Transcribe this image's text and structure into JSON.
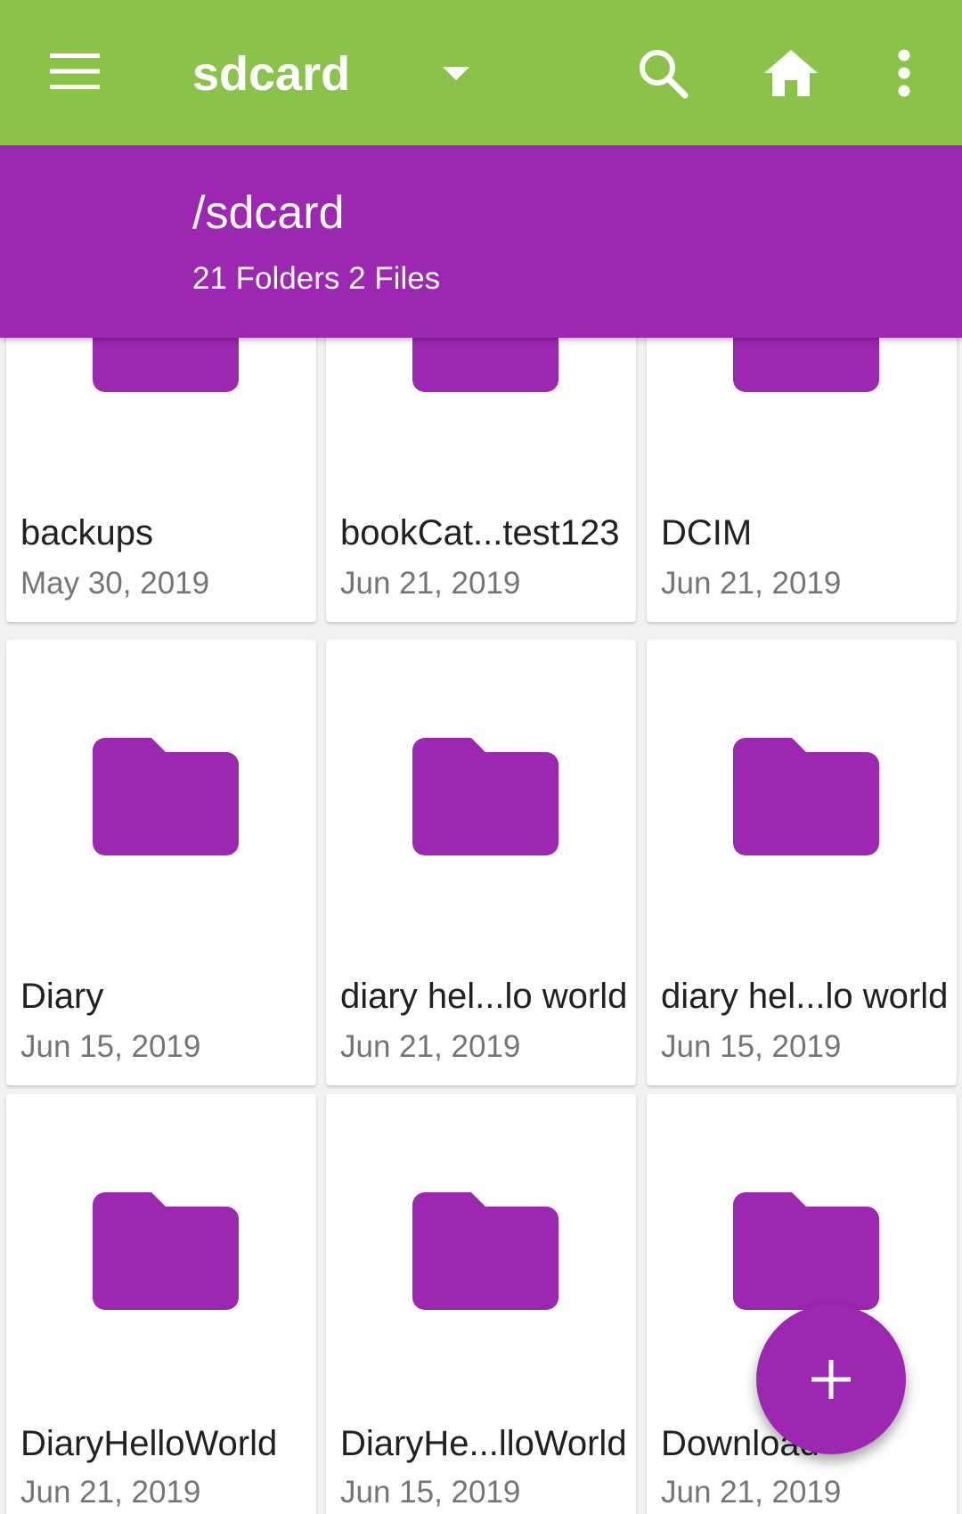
{
  "toolbar": {
    "title": "sdcard",
    "icons": [
      "menu-icon",
      "dropdown-arrow-icon",
      "search-icon",
      "home-icon",
      "more-vert-icon"
    ]
  },
  "path": {
    "current": "/sdcard",
    "summary": "21 Folders 2 Files"
  },
  "items": [
    {
      "name": "backups",
      "date": "May 30, 2019"
    },
    {
      "name": "bookCat...test123",
      "date": "Jun 21, 2019"
    },
    {
      "name": "DCIM",
      "date": "Jun 21, 2019"
    },
    {
      "name": "Diary",
      "date": "Jun 15, 2019"
    },
    {
      "name": "diary hel...lo world",
      "date": "Jun 21, 2019"
    },
    {
      "name": "diary hel...lo world",
      "date": "Jun 15, 2019"
    },
    {
      "name": "DiaryHelloWorld",
      "date": "Jun 21, 2019"
    },
    {
      "name": "DiaryHe...lloWorld",
      "date": "Jun 15, 2019"
    },
    {
      "name": "Download",
      "date": "Jun 21, 2019"
    }
  ],
  "colors": {
    "toolbar": "#8bc34a",
    "accent": "#9c27b0",
    "card": "#ffffff",
    "primary_text": "#212121",
    "secondary_text": "#757575"
  },
  "fab": {
    "icon": "plus-icon"
  }
}
